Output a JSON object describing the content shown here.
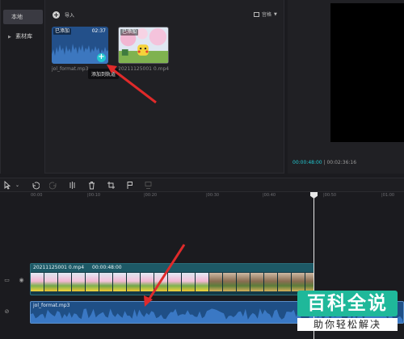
{
  "sidebar": {
    "items": [
      {
        "label": "本地",
        "active": true
      },
      {
        "label": "素材库",
        "expand_icon": "triangle-right"
      }
    ]
  },
  "media": {
    "import_label": "导入",
    "view_label": "宫格",
    "audio_card": {
      "badge": "已添加",
      "duration": "02:37",
      "name": "jol_format.mp3"
    },
    "video_card": {
      "badge": "已添加",
      "name": "20211125001 0.mp4"
    },
    "tooltip": "添加到轨道"
  },
  "player": {
    "current_time": "00:00:48:00",
    "separator": " | ",
    "total_time": "00:02:36:16"
  },
  "toolbar": {
    "tools": [
      "select-cursor-icon",
      "undo-icon",
      "redo-icon",
      "split-icon",
      "delete-icon",
      "marker-icon",
      "freeze-icon"
    ]
  },
  "ruler": {
    "labels": [
      "00:00",
      "|00:10",
      "|00:20",
      "|00:30",
      "|00:40",
      "|00:50",
      "|01:00"
    ]
  },
  "timeline": {
    "video_clip": {
      "name": "20211125001 0.mp4",
      "duration": "00:00:48:00"
    },
    "audio_clip": {
      "name": "jol_format.mp3"
    }
  },
  "watermark": {
    "title": "百科全说",
    "subtitle": "助你轻松解决"
  },
  "colors": {
    "accent": "#21c6cf",
    "audio_blue": "#1f4f86",
    "video_teal": "#1d5966",
    "annotation_red": "#e02a2a",
    "watermark_green": "#1fb89a"
  }
}
